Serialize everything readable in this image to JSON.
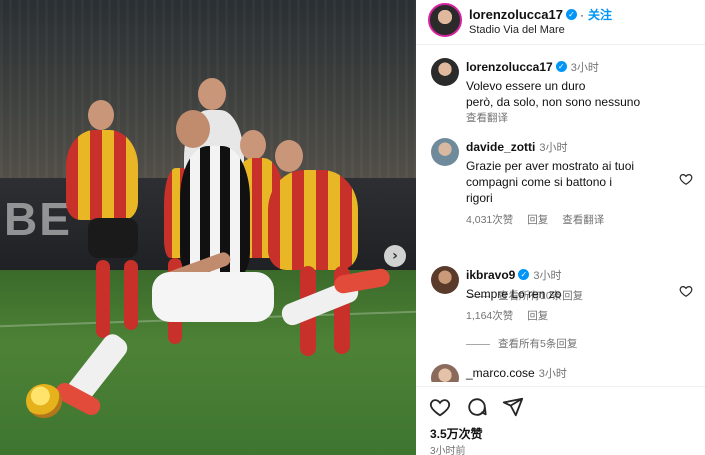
{
  "post": {
    "username": "lorenzolucca17",
    "follow_label": "关注",
    "location": "Stadio Via del Mare",
    "likes": "3.5万次赞",
    "posted_time": "3小时前"
  },
  "caption": {
    "username": "lorenzolucca17",
    "time": "3小时",
    "text_line1": "Volevo essere un duro",
    "text_line2": "però, da solo, non sono nessuno",
    "translate_label": "查看翻译"
  },
  "comments": [
    {
      "username": "davide_zotti",
      "time": "3小时",
      "text_lines": [
        "Grazie per aver mostrato ai tuoi",
        "compagni come si battono i",
        "rigori"
      ],
      "likes": "4,031次赞",
      "reply_label": "回复",
      "translate_label": "查看翻译",
      "view_replies": "查看所有10条回复"
    },
    {
      "username": "ikbravo9",
      "time": "3小时",
      "text_lines": [
        "Sempre Lo ren zo"
      ],
      "likes": "1,164次赞",
      "reply_label": "回复",
      "view_replies": "查看所有5条回复"
    },
    {
      "username": "_marco.cose",
      "time": "3小时"
    }
  ],
  "photo": {
    "board_text": "BE",
    "next_icon": "chevron-right-icon"
  },
  "icons": {
    "verified": "verified-badge-icon",
    "more": "ellipsis-icon",
    "like": "heart-icon",
    "comment": "comment-icon",
    "share": "send-icon"
  },
  "colors": {
    "accent": "#0095f6",
    "muted": "#737373",
    "juventus_black": "#111111",
    "lecce_red": "#c8302a",
    "lecce_yellow": "#e9b626"
  }
}
